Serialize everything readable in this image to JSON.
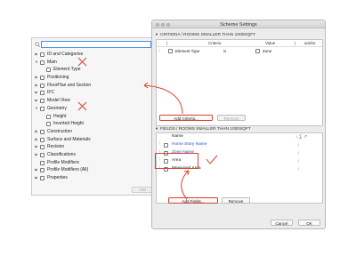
{
  "left_panel": {
    "search": {
      "value": "",
      "placeholder": ""
    },
    "tree": [
      {
        "arrow": "▶",
        "level": 0,
        "label": "ID and Categories",
        "icon": "folder-icon"
      },
      {
        "arrow": "▼",
        "level": 0,
        "label": "Main",
        "icon": "folder-icon"
      },
      {
        "arrow": "",
        "level": 1,
        "label": "Element Type",
        "icon": "element-type-icon"
      },
      {
        "arrow": "▶",
        "level": 0,
        "label": "Positioning",
        "icon": "folder-icon"
      },
      {
        "arrow": "▶",
        "level": 0,
        "label": "FloorPlan and Section",
        "icon": "folder-icon"
      },
      {
        "arrow": "▶",
        "level": 0,
        "label": "IFC",
        "icon": "folder-icon"
      },
      {
        "arrow": "▶",
        "level": 0,
        "label": "Model View",
        "icon": "folder-icon"
      },
      {
        "arrow": "▼",
        "level": 0,
        "label": "Geometry",
        "icon": "folder-icon"
      },
      {
        "arrow": "",
        "level": 1,
        "label": "Height",
        "icon": "height-icon"
      },
      {
        "arrow": "",
        "level": 1,
        "label": "Inverted Height",
        "icon": "height-icon"
      },
      {
        "arrow": "▶",
        "level": 0,
        "label": "Construction",
        "icon": "folder-icon"
      },
      {
        "arrow": "▶",
        "level": 0,
        "label": "Surface and Materials",
        "icon": "folder-icon"
      },
      {
        "arrow": "▶",
        "level": 0,
        "label": "Revision",
        "icon": "folder-icon"
      },
      {
        "arrow": "▶",
        "level": 0,
        "label": "Classifications",
        "icon": "folder-icon"
      },
      {
        "arrow": "",
        "level": 0,
        "label": "Profile Modifiers",
        "icon": "folder-icon"
      },
      {
        "arrow": "▶",
        "level": 0,
        "label": "Profile Modifiers (All)",
        "icon": "folder-icon"
      },
      {
        "arrow": "▶",
        "level": 0,
        "label": "Properties",
        "icon": "folder-icon"
      }
    ],
    "add_label": "Add"
  },
  "window": {
    "title": "Scheme Settings",
    "criteria": {
      "header": "CRITERIA / ROOMS SMALLER THAN 1000SQFT",
      "columns": [
        "(",
        "Criteria",
        "Value",
        ")",
        "and/or"
      ],
      "row": {
        "paren_open": "",
        "field": "Element Type",
        "op": "is",
        "value": "Zone"
      },
      "add_label": "Add Criteria...",
      "remove_label": "Remove"
    },
    "fields": {
      "header": "FIELDS / ROOMS SMALLER THAN 1000SQFT",
      "name_header": "Name",
      "sort_header": "↓ ∑ ↗",
      "rows": [
        {
          "label": "Home Story Name",
          "sort": "↓",
          "color": "blue"
        },
        {
          "label": "Zone Name",
          "sort": "↓",
          "color": "blue"
        },
        {
          "label": "Area",
          "sort": "↓",
          "color": "black"
        },
        {
          "label": "Measured Area",
          "sort": "↓",
          "color": "black"
        }
      ],
      "add_label": "Add Fields...",
      "remove_label": "Remove"
    },
    "cancel_label": "Cancel",
    "ok_label": "OK"
  },
  "colors": {
    "annotation_red": "#d9412c",
    "field_blue": "#2d4fc7",
    "selection_blue": "#4a90e2"
  }
}
